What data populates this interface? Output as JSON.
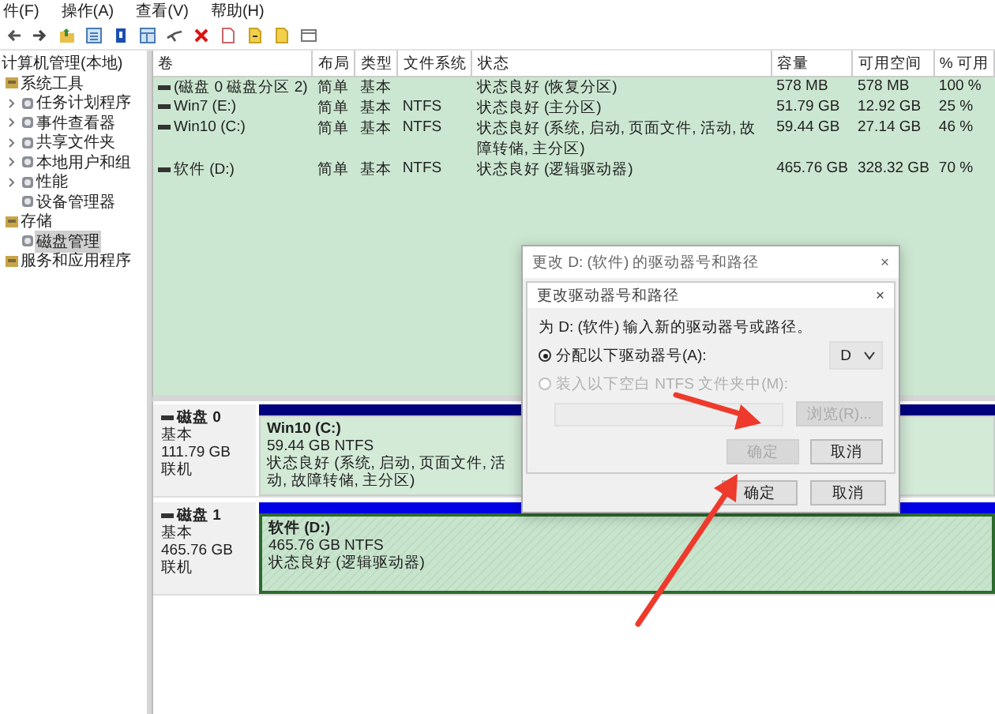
{
  "menu": [
    "件(F)",
    "操作(A)",
    "查看(V)",
    "帮助(H)"
  ],
  "tree": {
    "root": "计算机管理(本地)",
    "items": [
      {
        "label": "系统工具",
        "expandable": false,
        "selected": false,
        "children": [
          {
            "label": "任务计划程序",
            "expandable": true,
            "selected": false
          },
          {
            "label": "事件查看器",
            "expandable": true,
            "selected": false
          },
          {
            "label": "共享文件夹",
            "expandable": true,
            "selected": false
          },
          {
            "label": "本地用户和组",
            "expandable": true,
            "selected": false
          },
          {
            "label": "性能",
            "expandable": true,
            "selected": false
          },
          {
            "label": "设备管理器",
            "expandable": false,
            "selected": false
          }
        ]
      },
      {
        "label": "存储",
        "expandable": false,
        "selected": false,
        "children": [
          {
            "label": "磁盘管理",
            "expandable": false,
            "selected": true
          }
        ]
      },
      {
        "label": "服务和应用程序",
        "expandable": false,
        "selected": false
      }
    ]
  },
  "volumes": {
    "columns": [
      "卷",
      "布局",
      "类型",
      "文件系统",
      "状态",
      "容量",
      "可用空间",
      "% 可用"
    ],
    "rows": [
      {
        "volume": "(磁盘 0 磁盘分区 2)",
        "layout": "简单",
        "type": "基本",
        "status": "状态良好 (恢复分区)",
        "capacity": "578 MB",
        "free": "578 MB",
        "percent_free": "100 %"
      },
      {
        "volume": "Win7 (E:)",
        "layout": "简单",
        "type": "基本",
        "filesystem": "NTFS",
        "status": "状态良好 (主分区)",
        "capacity": "51.79 GB",
        "free": "12.92 GB",
        "percent_free": "25 %"
      },
      {
        "volume": "Win10 (C:)",
        "layout": "简单",
        "type": "基本",
        "filesystem": "NTFS",
        "status": "状态良好 (系统, 启动, 页面文件, 活动, 故障转储, 主分区)",
        "capacity": "59.44 GB",
        "free": "27.14 GB",
        "percent_free": "46 %"
      },
      {
        "volume": "软件 (D:)",
        "layout": "简单",
        "type": "基本",
        "filesystem": "NTFS",
        "status": "状态良好 (逻辑驱动器)",
        "capacity": "465.76 GB",
        "free": "328.32 GB",
        "percent_free": "70 %"
      }
    ]
  },
  "disks": [
    {
      "name": "磁盘 0",
      "type": "基本",
      "size": "111.79 GB",
      "state": "联机",
      "partitions": [
        {
          "label": "Win10 (C:)",
          "size_fs": "59.44 GB NTFS",
          "status": "状态良好 (系统, 启动, 页面文件, 活动, 故障转储, 主分区)",
          "kind": "primary",
          "selected": false
        }
      ]
    },
    {
      "name": "磁盘 1",
      "type": "基本",
      "size": "465.76 GB",
      "state": "联机",
      "partitions": [
        {
          "label": "软件 (D:)",
          "size_fs": "465.76 GB NTFS",
          "status": "状态良好 (逻辑驱动器)",
          "kind": "logical",
          "selected": true
        }
      ]
    }
  ],
  "dialog": {
    "title": "更改 D: (软件) 的驱动器号和路径",
    "close": "×",
    "inner": {
      "title": "更改驱动器号和路径",
      "close": "×",
      "prompt": "为 D: (软件) 输入新的驱动器号或路径。",
      "options": [
        {
          "label": "分配以下驱动器号(A):",
          "selected": true,
          "disabled": false
        },
        {
          "label": "装入以下空白 NTFS 文件夹中(M):",
          "selected": false,
          "disabled": true
        }
      ],
      "drive_letter": "D",
      "browse": {
        "label": "浏览(R)...",
        "disabled": true
      },
      "buttons": [
        {
          "label": "确定",
          "disabled": true
        },
        {
          "label": "取消",
          "disabled": false
        }
      ]
    },
    "buttons": [
      {
        "label": "确定",
        "disabled": false
      },
      {
        "label": "取消",
        "disabled": false
      }
    ]
  }
}
